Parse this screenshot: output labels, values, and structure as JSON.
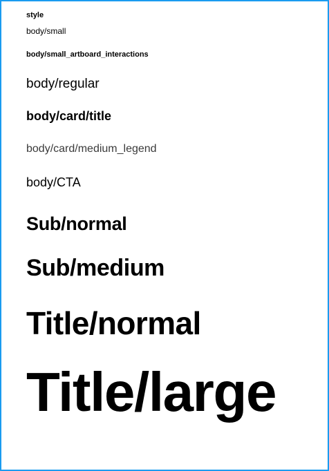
{
  "header": {
    "label": "style"
  },
  "styles": [
    {
      "name": "body/small"
    },
    {
      "name": "body/small_artboard_interactions"
    },
    {
      "name": "body/regular"
    },
    {
      "name": "body/card/title"
    },
    {
      "name": "body/card/medium_legend"
    },
    {
      "name": "body/CTA"
    },
    {
      "name": "Sub/normal"
    },
    {
      "name": "Sub/medium"
    },
    {
      "name": "Title/normal"
    },
    {
      "name": "Title/large"
    }
  ],
  "colors": {
    "frame_border": "#1a9bf0",
    "text": "#000000",
    "legend_text": "#3a3a3a",
    "background": "#ffffff"
  }
}
